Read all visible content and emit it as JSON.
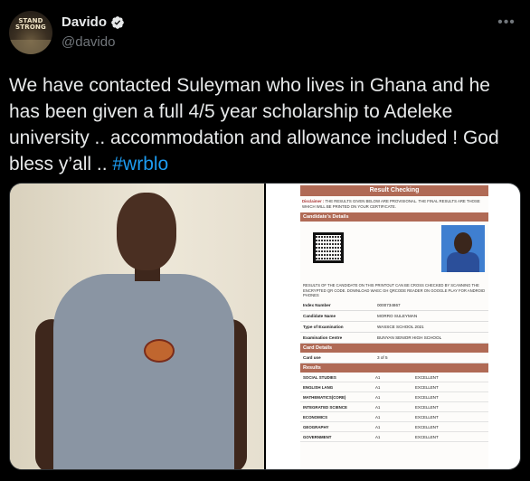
{
  "author": {
    "display_name": "Davido",
    "handle": "@davido",
    "avatar_text": "STAND STRONG",
    "verified": true,
    "more_icon": "ellipsis-icon"
  },
  "tweet": {
    "text": "We have contacted Suleyman who lives in Ghana and he has been given a full 4/5 year scholarship to Adeleke university .. accommodation and allowance included ! God bless y’all .. ",
    "hashtag": "#wrblo"
  },
  "colors": {
    "background": "#000000",
    "text": "#e7e9ea",
    "muted": "#71767b",
    "link": "#1d9bf0",
    "verified": "#1d9bf0",
    "doc_accent": "#b06a55"
  },
  "result_doc": {
    "title": "Result Checking",
    "disclaimer_label": "Disclaimer :",
    "disclaimer_text": "THE RESULTS GIVEN BELOW ARE PROVISIONAL. THE FINAL RESULTS ARE THOSE WHICH WILL BE PRINTED ON YOUR CERTIFICATE.",
    "candidate_heading": "Candidate's Details",
    "note": "RESULTS OF THE CANDIDATE ON THIS PRINTOUT CAN BE CROSS CHECKED BY SCANNING THE ENCRYPTED QR CODE. DOWNLOAD WAEC GH QRCODE READER ON GOOGLE PLAY FOR ANDROID PHONES",
    "details": [
      {
        "key": "Index Number",
        "value": "0000734867"
      },
      {
        "key": "Candidate Name",
        "value": "MORRO SULEYMAN"
      },
      {
        "key": "Type of Examination",
        "value": "WASSCE SCHOOL 2021"
      },
      {
        "key": "Examination Centre",
        "value": "BUNYAN SENIOR HIGH SCHOOL"
      }
    ],
    "card_heading": "Card Details",
    "card_use": {
      "key": "Card use",
      "value": "3 of 5"
    },
    "results_heading": "Results",
    "results": [
      {
        "subject": "SOCIAL STUDIES",
        "grade": "A1",
        "remark": "EXCELLENT"
      },
      {
        "subject": "ENGLISH LANG",
        "grade": "A1",
        "remark": "EXCELLENT"
      },
      {
        "subject": "MATHEMATICS(CORE)",
        "grade": "A1",
        "remark": "EXCELLENT"
      },
      {
        "subject": "INTEGRATED SCIENCE",
        "grade": "A1",
        "remark": "EXCELLENT"
      },
      {
        "subject": "ECONOMICS",
        "grade": "A1",
        "remark": "EXCELLENT"
      },
      {
        "subject": "GEOGRAPHY",
        "grade": "A1",
        "remark": "EXCELLENT"
      },
      {
        "subject": "GOVERNMENT",
        "grade": "A1",
        "remark": "EXCELLENT"
      }
    ]
  }
}
